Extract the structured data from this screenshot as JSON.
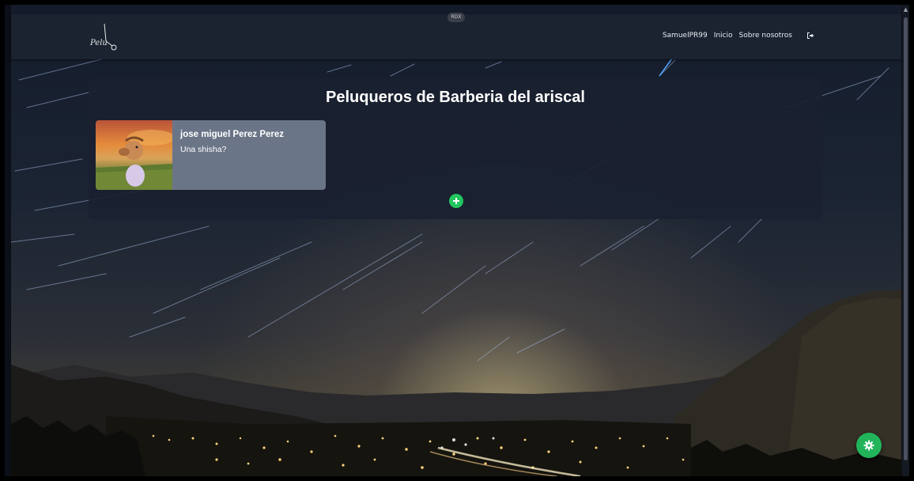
{
  "badge": {
    "label": "RDX"
  },
  "navbar": {
    "logo_text": "Pelu",
    "user": "SamuelPR99",
    "links": [
      {
        "label": "Inicio"
      },
      {
        "label": "Sobre nosotros"
      }
    ],
    "logout_icon": "logout-icon"
  },
  "main": {
    "title": "Peluqueros de Barberia del ariscal",
    "barbers": [
      {
        "name": "jose miguel Perez Perez",
        "description": "Una shisha?"
      }
    ],
    "add_icon": "plus-icon"
  },
  "floating": {
    "settings_icon": "gear-icon"
  },
  "colors": {
    "navbar": "#1b2331",
    "card": "#1a2130",
    "barber_card": "#6b7588",
    "accent_green": "#22c55e"
  }
}
